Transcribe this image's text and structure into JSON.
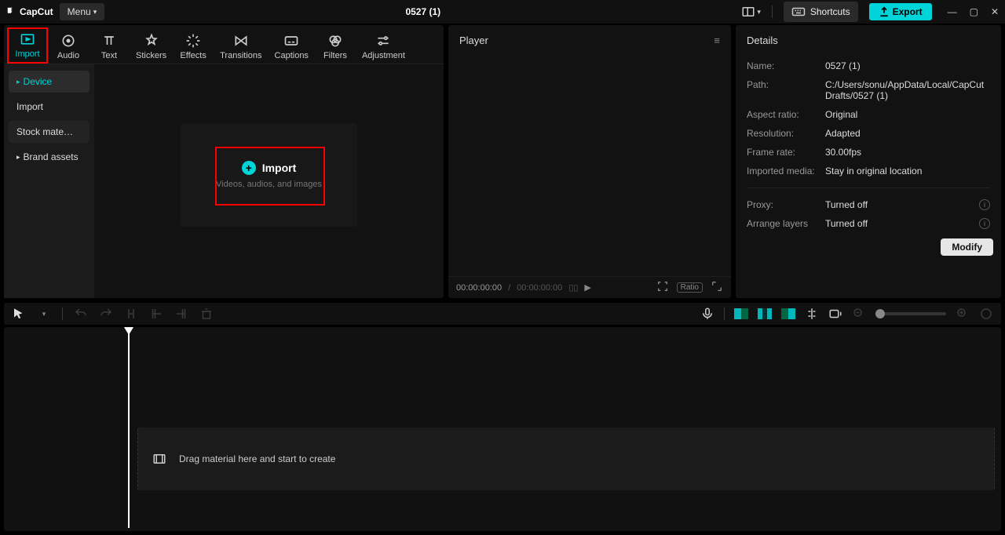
{
  "titlebar": {
    "app_name": "CapCut",
    "menu_label": "Menu",
    "project_title": "0527 (1)",
    "shortcuts_label": "Shortcuts",
    "export_label": "Export"
  },
  "tool_tabs": [
    {
      "id": "import",
      "label": "Import",
      "active": true
    },
    {
      "id": "audio",
      "label": "Audio"
    },
    {
      "id": "text",
      "label": "Text"
    },
    {
      "id": "stickers",
      "label": "Stickers"
    },
    {
      "id": "effects",
      "label": "Effects"
    },
    {
      "id": "transitions",
      "label": "Transitions"
    },
    {
      "id": "captions",
      "label": "Captions"
    },
    {
      "id": "filters",
      "label": "Filters"
    },
    {
      "id": "adjustment",
      "label": "Adjustment"
    }
  ],
  "sidebar": {
    "items": [
      {
        "id": "device",
        "label": "Device",
        "selected": true,
        "marker": "▸"
      },
      {
        "id": "import",
        "label": "Import"
      },
      {
        "id": "stock",
        "label": "Stock mate…",
        "alt": true
      },
      {
        "id": "brand",
        "label": "Brand assets",
        "marker": "▸"
      }
    ]
  },
  "import_card": {
    "title": "Import",
    "subtitle": "Videos, audios, and images"
  },
  "player": {
    "header": "Player",
    "time_current": "00:00:00:00",
    "time_sep": " / ",
    "time_total": "00:00:00:00",
    "ratio_label": "Ratio"
  },
  "details": {
    "header": "Details",
    "rows": {
      "name_label": "Name:",
      "name_value": "0527 (1)",
      "path_label": "Path:",
      "path_value": "C:/Users/sonu/AppData/Local/CapCut Drafts/0527 (1)",
      "aspect_label": "Aspect ratio:",
      "aspect_value": "Original",
      "res_label": "Resolution:",
      "res_value": "Adapted",
      "fps_label": "Frame rate:",
      "fps_value": "30.00fps",
      "imported_label": "Imported media:",
      "imported_value": "Stay in original location",
      "proxy_label": "Proxy:",
      "proxy_value": "Turned off",
      "layers_label": "Arrange layers",
      "layers_value": "Turned off"
    },
    "modify_label": "Modify"
  },
  "timeline": {
    "hint": "Drag material here and start to create"
  }
}
